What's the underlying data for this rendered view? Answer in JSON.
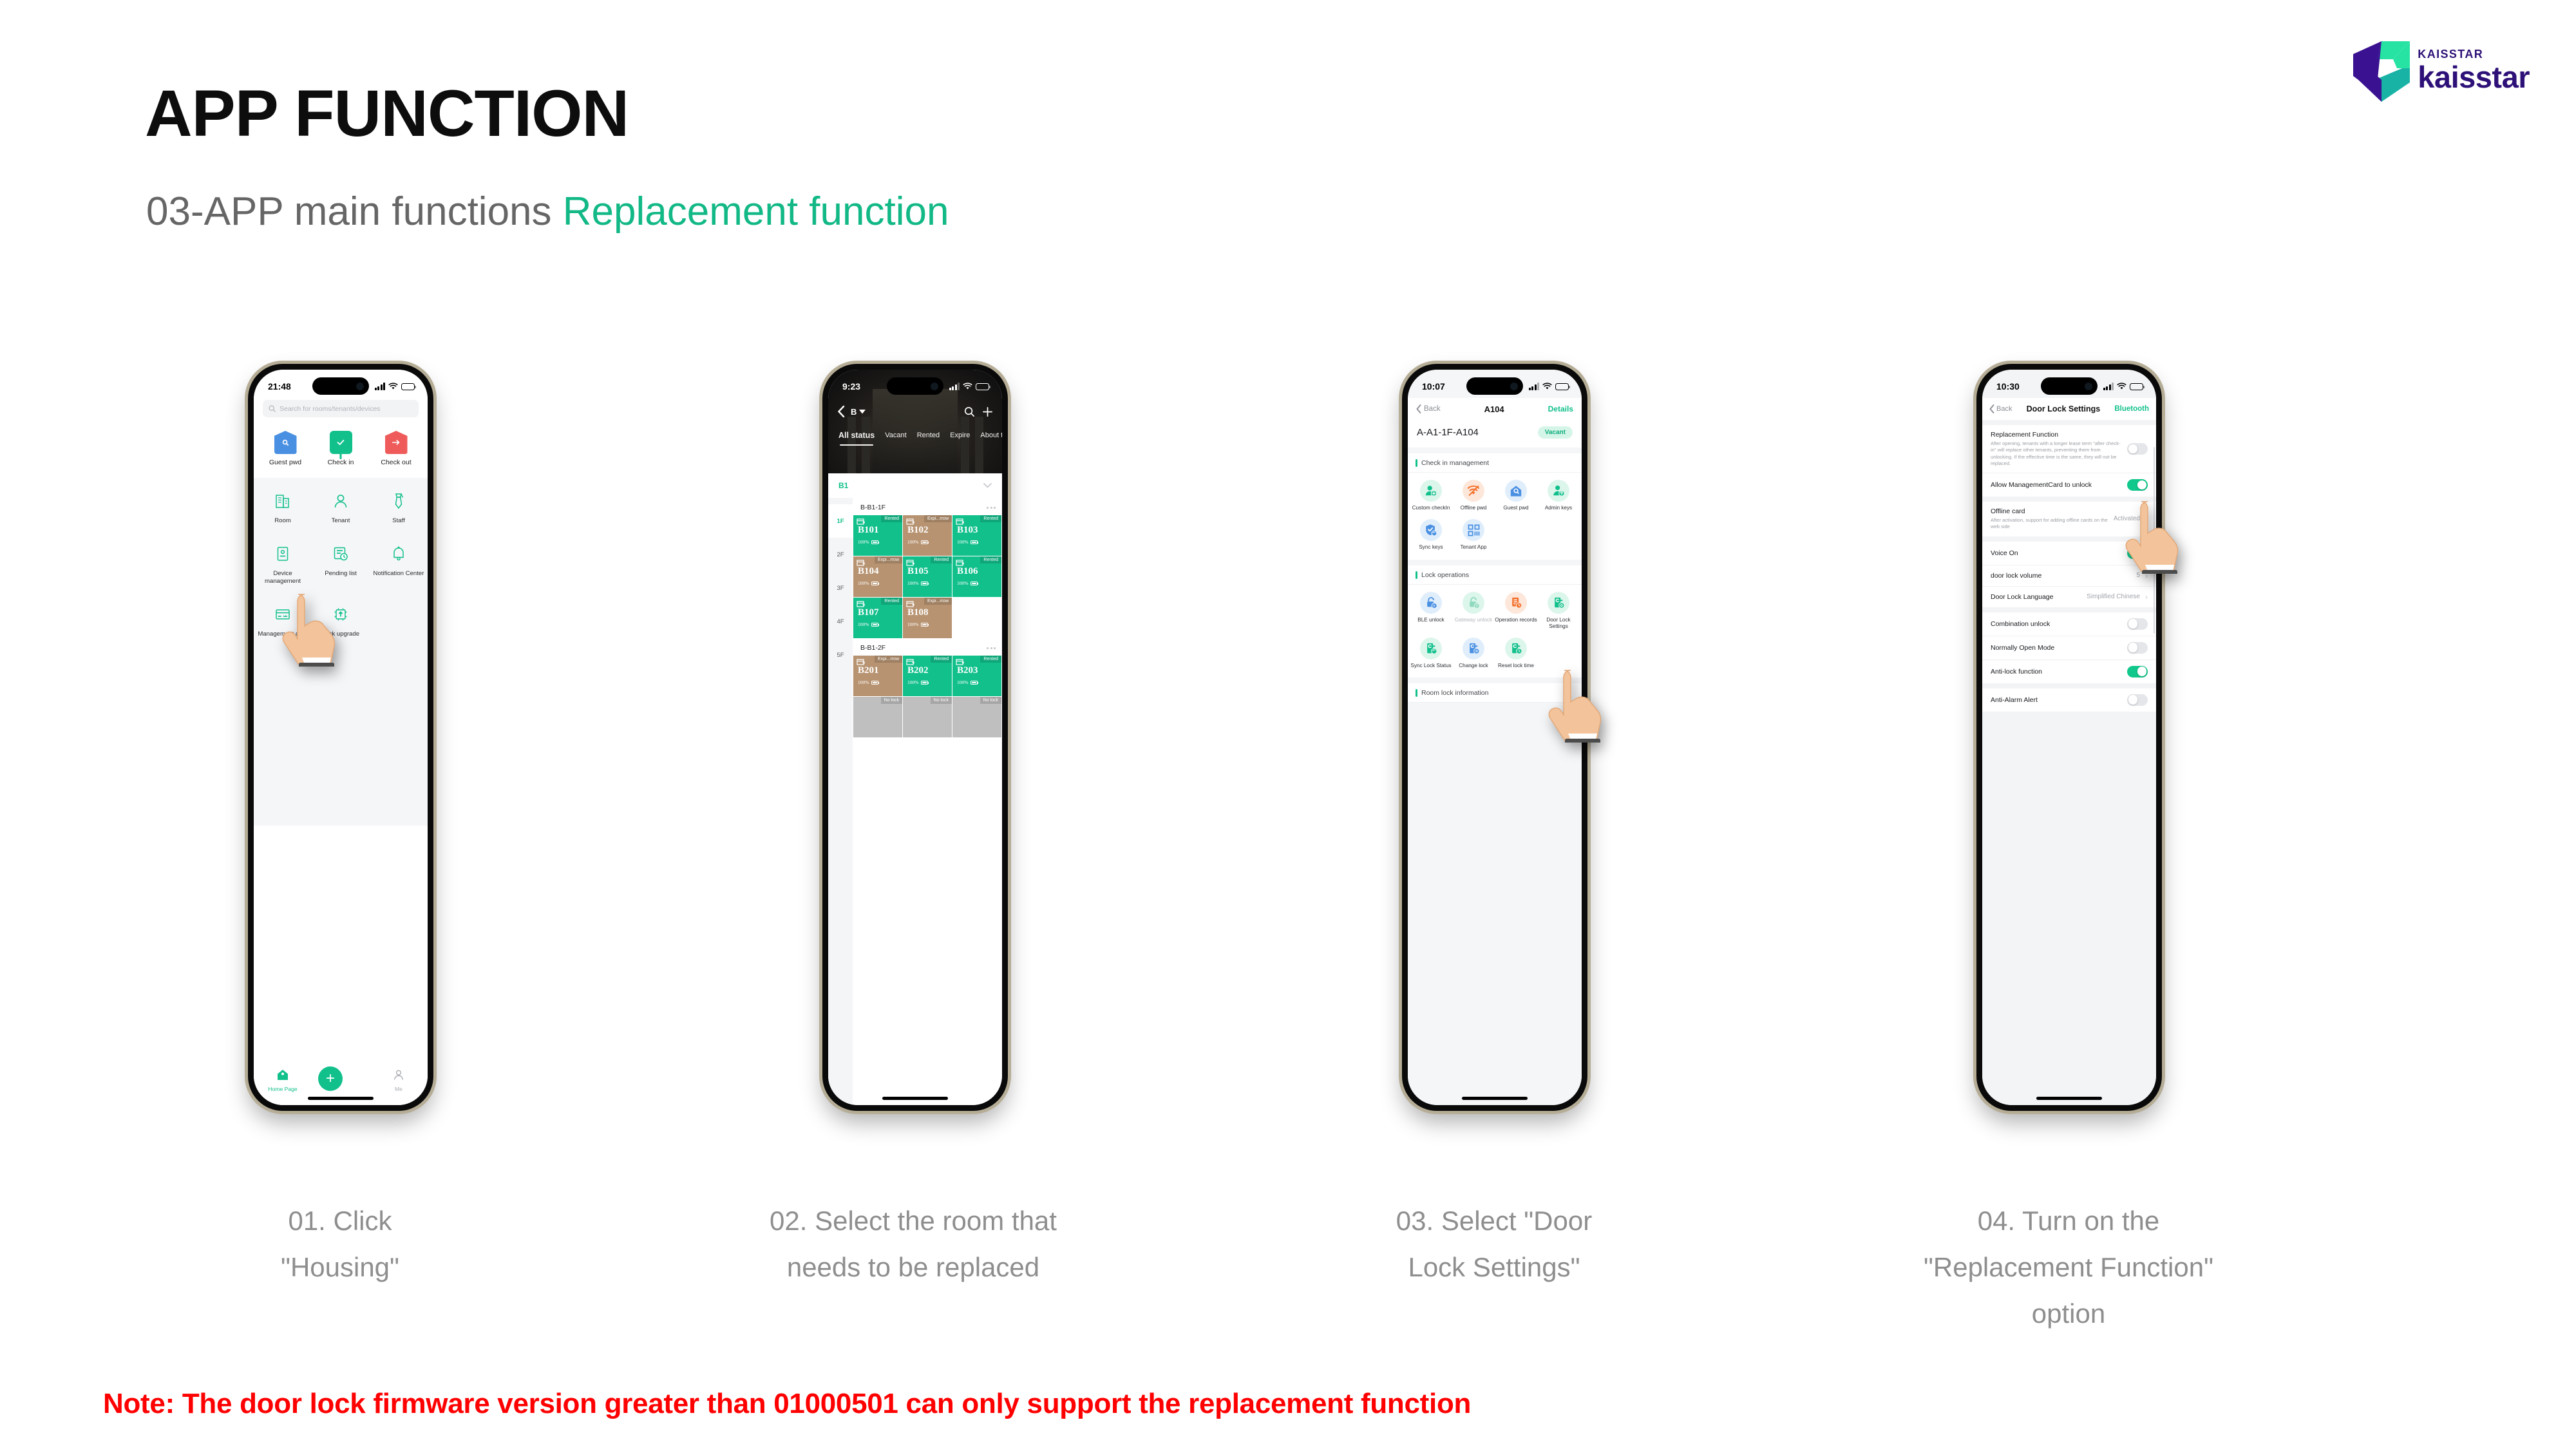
{
  "header": {
    "title": "APP FUNCTION",
    "subtitle_plain": "03-APP main functions ",
    "subtitle_highlight": "Replacement function",
    "accent_green": "#12b886"
  },
  "logo": {
    "small": "KAISSTAR",
    "big": "kaisstar",
    "purple": "#2e1178",
    "teal": "#19b3a6",
    "mint": "#27e3a3"
  },
  "phone1": {
    "status": {
      "time": "21:48"
    },
    "search": {
      "placeholder": "Search for rooms/tenants/devices",
      "icon": "search-icon"
    },
    "top_actions": [
      {
        "label": "Guest pwd",
        "icon": "house-search-icon",
        "color": "#4a90e2"
      },
      {
        "label": "Check in",
        "icon": "check-board-icon",
        "color": "#12c08b"
      },
      {
        "label": "Check out",
        "icon": "arrow-right-house-icon",
        "color": "#ef5b5b"
      }
    ],
    "grid": [
      {
        "label": "Room",
        "icon": "building-icon"
      },
      {
        "label": "Tenant",
        "icon": "person-icon"
      },
      {
        "label": "Staff",
        "icon": "necktie-icon"
      },
      {
        "label": "Device management",
        "icon": "device-card-icon"
      },
      {
        "label": "Pending list",
        "icon": "list-clock-icon"
      },
      {
        "label": "Notification Center",
        "icon": "bell-icon"
      },
      {
        "label": "Management card",
        "icon": "card-crown-icon"
      },
      {
        "label": "Lock upgrade",
        "icon": "chip-upload-icon"
      }
    ],
    "tabbar": {
      "home": "Home Page",
      "add": "+",
      "me": "Me"
    }
  },
  "phone2": {
    "status": {
      "time": "9:23"
    },
    "nav": {
      "building": "B",
      "search_icon": "search-icon",
      "add_icon": "plus-icon",
      "back_icon": "chevron-left-icon"
    },
    "tabs": [
      "All status",
      "Vacant",
      "Rented",
      "Expire",
      "About t"
    ],
    "active_tab": "All status",
    "building_label": "B1",
    "floors": [
      {
        "label": "1F",
        "active": true
      },
      {
        "label": "2F",
        "active": false
      },
      {
        "label": "3F",
        "active": false
      },
      {
        "label": "4F",
        "active": false
      },
      {
        "label": "5F",
        "active": false
      }
    ],
    "sections": [
      {
        "name": "B-B1-1F",
        "rooms": [
          {
            "room": "B101",
            "status": "Rented",
            "battery": "100%",
            "color": "green"
          },
          {
            "room": "B102",
            "status": "Expi...rrow",
            "battery": "100%",
            "color": "tan"
          },
          {
            "room": "B103",
            "status": "Rented",
            "battery": "100%",
            "color": "green"
          },
          {
            "room": "B104",
            "status": "Expi...rrow",
            "battery": "100%",
            "color": "tan"
          },
          {
            "room": "B105",
            "status": "Rented",
            "battery": "100%",
            "color": "green"
          },
          {
            "room": "B106",
            "status": "Rented",
            "battery": "100%",
            "color": "green"
          },
          {
            "room": "B107",
            "status": "Rented",
            "battery": "100%",
            "color": "green"
          },
          {
            "room": "B108",
            "status": "Expi...rrow",
            "battery": "100%",
            "color": "tan"
          }
        ]
      },
      {
        "name": "B-B1-2F",
        "rooms": [
          {
            "room": "B201",
            "status": "Expi...rrow",
            "battery": "100%",
            "color": "tan"
          },
          {
            "room": "B202",
            "status": "Rented",
            "battery": "100%",
            "color": "green"
          },
          {
            "room": "B203",
            "status": "Rented",
            "battery": "100%",
            "color": "green"
          },
          {
            "room": "",
            "status": "No lock",
            "battery": "",
            "color": "gray"
          },
          {
            "room": "",
            "status": "No lock",
            "battery": "",
            "color": "gray"
          },
          {
            "room": "",
            "status": "No lock",
            "battery": "",
            "color": "gray"
          }
        ]
      }
    ]
  },
  "phone3": {
    "status": {
      "time": "10:07"
    },
    "nav": {
      "back": "Back",
      "title": "A104",
      "details": "Details"
    },
    "room": {
      "full_name": "A-A1-1F-A104",
      "status": "Vacant"
    },
    "sections": [
      {
        "title": "Check in management",
        "items": [
          {
            "label": "Custom checkIn",
            "icon": "person-add-icon",
            "bubble": "#ddf6ec",
            "fg": "#12c08b"
          },
          {
            "label": "Offline pwd",
            "icon": "wifi-off-icon",
            "bubble": "#fde7da",
            "fg": "#f3702a"
          },
          {
            "label": "Guest pwd",
            "icon": "house-search-icon",
            "bubble": "#e0eefc",
            "fg": "#4a90e2"
          },
          {
            "label": "Admin keys",
            "icon": "person-key-icon",
            "bubble": "#ddf6ec",
            "fg": "#12c08b"
          },
          {
            "label": "Sync keys",
            "icon": "shield-sync-icon",
            "bubble": "#e0eefc",
            "fg": "#4a90e2"
          },
          {
            "label": "Tenant App",
            "icon": "qr-grid-icon",
            "bubble": "#e0eefc",
            "fg": "#4a90e2"
          }
        ]
      },
      {
        "title": "Lock operations",
        "items": [
          {
            "label": "BLE unlock",
            "icon": "lock-bluetooth-icon",
            "bubble": "#e0eefc",
            "fg": "#4a90e2"
          },
          {
            "label": "Gateway unlock",
            "icon": "lock-wifi-icon",
            "bubble": "#ddf6ec",
            "fg": "#8fd9bf",
            "disabled": true
          },
          {
            "label": "Operation records",
            "icon": "records-clock-icon",
            "bubble": "#fde7da",
            "fg": "#f3702a"
          },
          {
            "label": "Door Lock Settings",
            "icon": "door-lock-settings-icon",
            "bubble": "#ddf6ec",
            "fg": "#12c08b"
          },
          {
            "label": "Sync Lock Status",
            "icon": "door-lock-sync-icon",
            "bubble": "#ddf6ec",
            "fg": "#12c08b"
          },
          {
            "label": "Change lock",
            "icon": "door-lock-change-icon",
            "bubble": "#e0eefc",
            "fg": "#4a90e2"
          },
          {
            "label": "Reset lock time",
            "icon": "door-lock-time-icon",
            "bubble": "#ddf6ec",
            "fg": "#12c08b"
          }
        ]
      },
      {
        "title": "Room lock information",
        "items": []
      }
    ]
  },
  "phone4": {
    "status": {
      "time": "10:30"
    },
    "nav": {
      "back": "Back",
      "title": "Door Lock Settings",
      "bluetooth": "Bluetooth"
    },
    "rows": [
      {
        "title": "Replacement Function",
        "desc": "After opening, tenants with a longer lease term \"after check-in\" will replace other tenants, preventing them from unlocking. If the effective time is the same, they will not be replaced.",
        "control": "toggle",
        "on": false
      },
      {
        "title": "Allow ManagementCard to unlock",
        "desc": "",
        "control": "toggle",
        "on": true
      },
      {
        "title": "Offline card",
        "desc": "After activation, support for adding offline cards on the web side",
        "control": "value-chevron",
        "value": "Activated"
      },
      {
        "title": "Voice On",
        "desc": "",
        "control": "toggle",
        "on": true
      },
      {
        "title": "door lock volume",
        "desc": "",
        "control": "value-chevron",
        "value": "5"
      },
      {
        "title": "Door Lock Language",
        "desc": "",
        "control": "value-chevron",
        "value": "Simplified Chinese"
      },
      {
        "title": "Combination unlock",
        "desc": "",
        "control": "toggle",
        "on": false
      },
      {
        "title": "Normally Open Mode",
        "desc": "",
        "control": "toggle",
        "on": false
      },
      {
        "title": "Anti-lock function",
        "desc": "",
        "control": "toggle",
        "on": true
      },
      {
        "title": "Anti-Alarm Alert",
        "desc": "",
        "control": "toggle",
        "on": false
      }
    ]
  },
  "captions": [
    "01. Click\n\"Housing\"",
    "02. Select the room that\nneeds to be replaced",
    "03. Select \"Door\nLock Settings\"",
    "04. Turn on the\n\"Replacement Function\"\noption"
  ],
  "note": "Note: The door lock firmware version greater than 01000501 can only support the replacement function"
}
